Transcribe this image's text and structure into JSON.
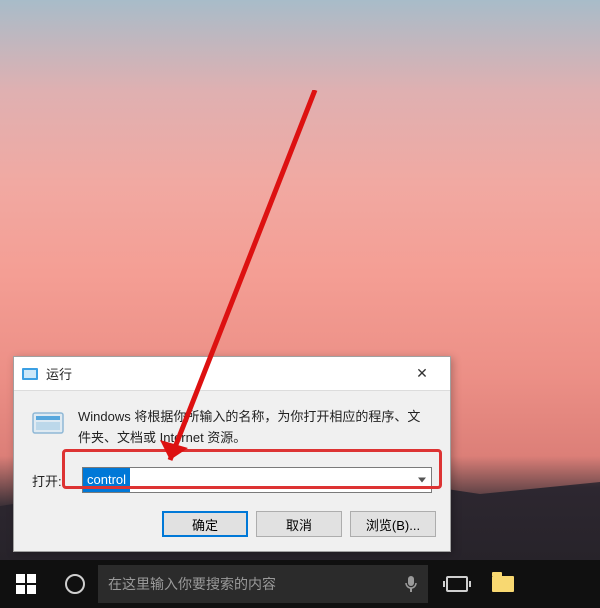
{
  "dialog": {
    "title": "运行",
    "description": "Windows 将根据你所输入的名称，为你打开相应的程序、文件夹、文档或 Internet 资源。",
    "open_label": "打开:",
    "input_value": "control",
    "buttons": {
      "ok": "确定",
      "cancel": "取消",
      "browse": "浏览(B)..."
    },
    "close_glyph": "✕"
  },
  "taskbar": {
    "search_placeholder": "在这里输入你要搜索的内容"
  }
}
